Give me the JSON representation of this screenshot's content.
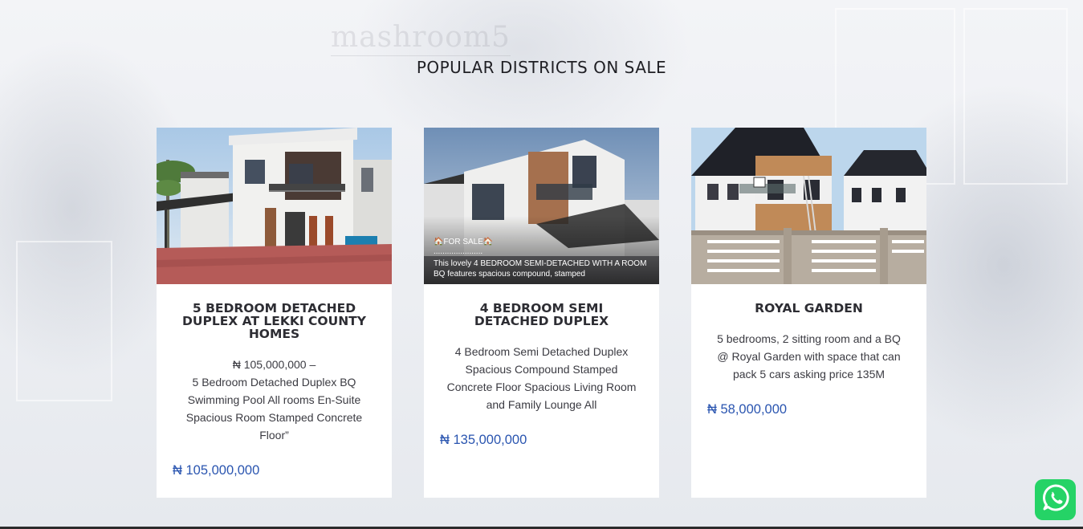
{
  "section": {
    "title": "POPULAR DISTRICTS ON SALE"
  },
  "watermark": "mashroom5",
  "cards": [
    {
      "title": "5 BEDROOM DETACHED DUPLEX AT LEKKI COUNTY HOMES",
      "price_line": "₦ 105,000,000 –",
      "description": "5 Bedroom Detached Duplex BQ Swimming Pool All rooms En-Suite Spacious Room Stamped Concrete Floor”",
      "price": "₦ 105,000,000"
    },
    {
      "title": "4 BEDROOM SEMI DETACHED DUPLEX",
      "image_caption_tag": "🏠FOR SALE🏠",
      "image_caption_dots": "......................",
      "image_caption_text": "This lovely 4 BEDROOM SEMI-DETACHED WITH A ROOM BQ features spacious compound, stamped",
      "description": "4 Bedroom Semi Detached Duplex Spacious Compound Stamped Concrete Floor Spacious Living Room and Family Lounge All",
      "price": "₦ 135,000,000"
    },
    {
      "title": "ROYAL GARDEN",
      "description": "5 bedrooms, 2 sitting room and a BQ @ Royal Garden with space that can pack 5 cars asking price 135M",
      "price": "₦ 58,000,000"
    }
  ],
  "colors": {
    "price": "#2a55b0",
    "whatsapp": "#25d366"
  },
  "icons": {
    "chat": "whatsapp-icon"
  }
}
